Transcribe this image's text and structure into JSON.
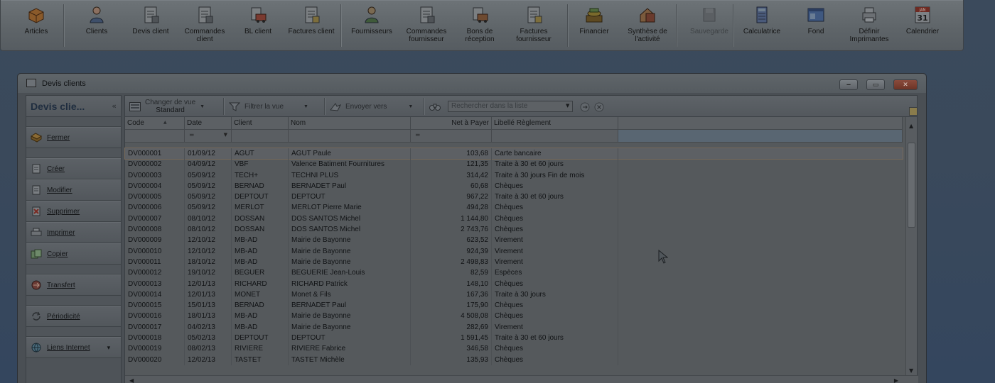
{
  "toolbar": {
    "buttons": [
      {
        "label": "Articles",
        "icon": "box-icon"
      },
      {
        "label": "Clients",
        "icon": "person-icon"
      },
      {
        "label": "Devis client",
        "icon": "quote-icon"
      },
      {
        "label": "Commandes client",
        "icon": "order-icon"
      },
      {
        "label": "BL client",
        "icon": "delivery-truck-icon"
      },
      {
        "label": "Factures client",
        "icon": "invoice-icon"
      },
      {
        "label": "Fournisseurs",
        "icon": "supplier-person-icon"
      },
      {
        "label": "Commandes fournisseur",
        "icon": "supplier-order-icon"
      },
      {
        "label": "Bons de réception",
        "icon": "reception-truck-icon"
      },
      {
        "label": "Factures fournisseur",
        "icon": "supplier-invoice-icon"
      },
      {
        "label": "Financier",
        "icon": "money-icon"
      },
      {
        "label": "Synthèse de l'activité",
        "icon": "house-chart-icon"
      },
      {
        "label": "Sauvegarde",
        "icon": "floppy-disk-icon"
      },
      {
        "label": "Calculatrice",
        "icon": "calculator-icon"
      },
      {
        "label": "Fond",
        "icon": "background-window-icon"
      },
      {
        "label": "Définir Imprimantes",
        "icon": "printer-icon"
      },
      {
        "label": "Calendrier",
        "icon": "calendar-icon"
      }
    ],
    "calendar_badge_month": "JAN",
    "calendar_badge_day": "31"
  },
  "window": {
    "title": "Devis clients",
    "minimize": "‒",
    "maximize": "▭",
    "close": "✕"
  },
  "side": {
    "title": "Devis clie...",
    "collapse": "«",
    "buttons": [
      {
        "label": "Fermer",
        "icon": "close-folder-icon"
      },
      {
        "label": "Créer",
        "icon": "new-document-icon"
      },
      {
        "label": "Modifier",
        "icon": "edit-document-icon"
      },
      {
        "label": "Supprimer",
        "icon": "delete-document-icon"
      },
      {
        "label": "Imprimer",
        "icon": "print-icon"
      },
      {
        "label": "Copier",
        "icon": "copy-icon"
      },
      {
        "label": "Transfert",
        "icon": "transfer-icon"
      },
      {
        "label": "Périodicité",
        "icon": "refresh-icon"
      },
      {
        "label": "Liens Internet",
        "icon": "web-link-icon"
      }
    ]
  },
  "list_toolbar": {
    "change_view": "Changer de vue",
    "view_name": "Standard",
    "filter": "Filtrer la vue",
    "send_to": "Envoyer vers",
    "search_placeholder": "Rechercher dans la liste"
  },
  "grid": {
    "columns": [
      "Code",
      "Date",
      "Client",
      "Nom",
      "Net à Payer",
      "Libellé Règlement"
    ],
    "filter_date": "=",
    "filter_net": "=",
    "rows": [
      [
        "DV000001",
        "01/09/12",
        "AGUT",
        "AGUT Paule",
        "103,68",
        "Carte bancaire"
      ],
      [
        "DV000002",
        "04/09/12",
        "VBF",
        "Valence Batiment Fournitures",
        "121,35",
        "Traite à 30 et 60 jours"
      ],
      [
        "DV000003",
        "05/09/12",
        "TECH+",
        "TECHNI PLUS",
        "314,42",
        "Traite à 30 jours Fin de mois"
      ],
      [
        "DV000004",
        "05/09/12",
        "BERNAD",
        "BERNADET Paul",
        "60,68",
        "Chèques"
      ],
      [
        "DV000005",
        "05/09/12",
        "DEPTOUT",
        "DEPTOUT",
        "967,22",
        "Traite à 30 et 60 jours"
      ],
      [
        "DV000006",
        "05/09/12",
        "MERLOT",
        "MERLOT Pierre Marie",
        "494,28",
        "Chèques"
      ],
      [
        "DV000007",
        "08/10/12",
        "DOSSAN",
        "DOS SANTOS Michel",
        "1 144,80",
        "Chèques"
      ],
      [
        "DV000008",
        "08/10/12",
        "DOSSAN",
        "DOS SANTOS Michel",
        "2 743,76",
        "Chèques"
      ],
      [
        "DV000009",
        "12/10/12",
        "MB-AD",
        "Mairie de Bayonne",
        "623,52",
        "Virement"
      ],
      [
        "DV000010",
        "12/10/12",
        "MB-AD",
        "Mairie de Bayonne",
        "924,39",
        "Virement"
      ],
      [
        "DV000011",
        "18/10/12",
        "MB-AD",
        "Mairie de Bayonne",
        "2 498,83",
        "Virement"
      ],
      [
        "DV000012",
        "19/10/12",
        "BEGUER",
        "BEGUERIE Jean-Louis",
        "82,59",
        "Espèces"
      ],
      [
        "DV000013",
        "12/01/13",
        "RICHARD",
        "RICHARD Patrick",
        "148,10",
        "Chèques"
      ],
      [
        "DV000014",
        "12/01/13",
        "MONET",
        "Monet & Fils",
        "167,36",
        "Traite à 30 jours"
      ],
      [
        "DV000015",
        "15/01/13",
        "BERNAD",
        "BERNADET Paul",
        "175,90",
        "Chèques"
      ],
      [
        "DV000016",
        "18/01/13",
        "MB-AD",
        "Mairie de Bayonne",
        "4 508,08",
        "Chèques"
      ],
      [
        "DV000017",
        "04/02/13",
        "MB-AD",
        "Mairie de Bayonne",
        "282,69",
        "Virement"
      ],
      [
        "DV000018",
        "05/02/13",
        "DEPTOUT",
        "DEPTOUT",
        "1 591,45",
        "Traite à 30 et 60 jours"
      ],
      [
        "DV000019",
        "08/02/13",
        "RIVIERE",
        "RIVIERE Fabrice",
        "346,58",
        "Chèques"
      ],
      [
        "DV000020",
        "12/02/13",
        "TASTET",
        "TASTET Michèle",
        "135,93",
        "Chèques"
      ]
    ]
  }
}
